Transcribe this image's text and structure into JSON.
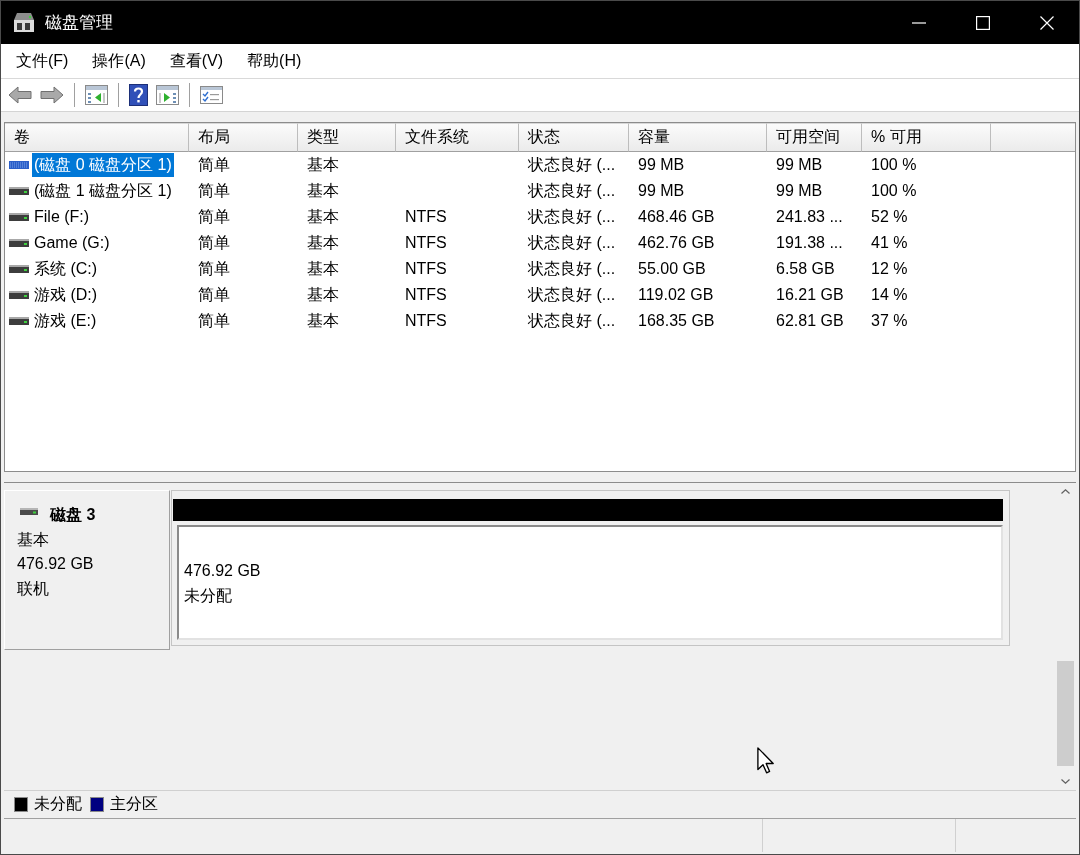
{
  "window": {
    "title": "磁盘管理"
  },
  "menu": [
    "文件(F)",
    "操作(A)",
    "查看(V)",
    "帮助(H)"
  ],
  "volume_list": {
    "columns": [
      "卷",
      "布局",
      "类型",
      "文件系统",
      "状态",
      "容量",
      "可用空间",
      "% 可用"
    ],
    "rows": [
      {
        "selected": true,
        "volume": "(磁盘 0 磁盘分区 1)",
        "layout": "简单",
        "type": "基本",
        "status": "状态良好 (...",
        "capacity": "99 MB",
        "free_space": "99 MB",
        "percent_free": "100 %"
      },
      {
        "selected": false,
        "volume": "(磁盘 1 磁盘分区 1)",
        "layout": "简单",
        "type": "基本",
        "status": "状态良好 (...",
        "capacity": "99 MB",
        "free_space": "99 MB",
        "percent_free": "100 %"
      },
      {
        "selected": false,
        "volume": "File (F:)",
        "layout": "简单",
        "type": "基本",
        "file_system": "NTFS",
        "status": "状态良好 (...",
        "capacity": "468.46 GB",
        "free_space": "241.83 ...",
        "percent_free": "52 %"
      },
      {
        "selected": false,
        "volume": "Game (G:)",
        "layout": "简单",
        "type": "基本",
        "file_system": "NTFS",
        "status": "状态良好 (...",
        "capacity": "462.76 GB",
        "free_space": "191.38 ...",
        "percent_free": "41 %"
      },
      {
        "selected": false,
        "volume": "系统 (C:)",
        "layout": "简单",
        "type": "基本",
        "file_system": "NTFS",
        "status": "状态良好 (...",
        "capacity": "55.00 GB",
        "free_space": "6.58 GB",
        "percent_free": "12 %"
      },
      {
        "selected": false,
        "volume": "游戏 (D:)",
        "layout": "简单",
        "type": "基本",
        "file_system": "NTFS",
        "status": "状态良好 (...",
        "capacity": "119.02 GB",
        "free_space": "16.21 GB",
        "percent_free": "14 %"
      },
      {
        "selected": false,
        "volume": "游戏 (E:)",
        "layout": "简单",
        "type": "基本",
        "file_system": "NTFS",
        "status": "状态良好 (...",
        "capacity": "168.35 GB",
        "free_space": "62.81 GB",
        "percent_free": "37 %"
      }
    ]
  },
  "disk_view": {
    "disks": [
      {
        "name": "磁盘 3",
        "type": "基本",
        "size": "476.92 GB",
        "status": "联机",
        "partitions": [
          {
            "size": "476.92 GB",
            "label": "未分配",
            "color": "#000000"
          }
        ]
      }
    ]
  },
  "legend": [
    {
      "label": "未分配",
      "color": "#000000"
    },
    {
      "label": "主分区",
      "color": "#000080"
    }
  ]
}
